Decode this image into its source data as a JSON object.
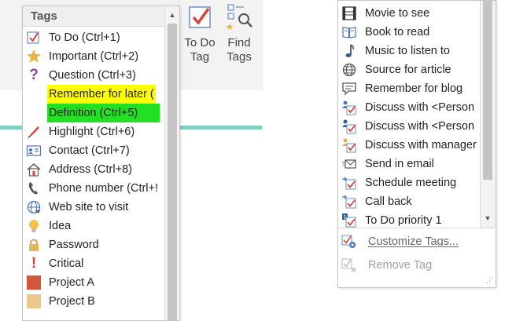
{
  "ribbon": {
    "todo_tag_label": [
      "To Do",
      "Tag"
    ],
    "find_tags_label": [
      "Find",
      "Tags"
    ]
  },
  "left_menu": {
    "header": "Tags",
    "items": [
      {
        "label": "To Do (Ctrl+1)",
        "icon": "checkbox-icon"
      },
      {
        "label": "Important (Ctrl+2)",
        "icon": "star-icon"
      },
      {
        "label": "Question (Ctrl+3)",
        "icon": "question-icon"
      },
      {
        "label": "Remember for later (",
        "icon": "",
        "highlight": "#ffff00"
      },
      {
        "label": "Definition (Ctrl+5)",
        "icon": "",
        "highlight": "#22e022"
      },
      {
        "label": "Highlight (Ctrl+6)",
        "icon": "highlighter-icon"
      },
      {
        "label": "Contact (Ctrl+7)",
        "icon": "contact-card-icon"
      },
      {
        "label": "Address (Ctrl+8)",
        "icon": "house-icon"
      },
      {
        "label": "Phone number (Ctrl+!",
        "icon": "phone-icon"
      },
      {
        "label": "Web site to visit",
        "icon": "globe-icon"
      },
      {
        "label": "Idea",
        "icon": "lightbulb-icon"
      },
      {
        "label": "Password",
        "icon": "padlock-icon"
      },
      {
        "label": "Critical",
        "icon": "exclamation-icon"
      },
      {
        "label": "Project A",
        "icon": "red-square-icon"
      },
      {
        "label": "Project B",
        "icon": "tan-square-icon"
      }
    ]
  },
  "right_menu": {
    "items": [
      {
        "label": "Movie to see",
        "icon": "film-icon"
      },
      {
        "label": "Book to read",
        "icon": "book-icon"
      },
      {
        "label": "Music to listen to",
        "icon": "music-note-icon"
      },
      {
        "label": "Source for article",
        "icon": "globe-icon"
      },
      {
        "label": "Remember for blog",
        "icon": "speech-bubble-icon"
      },
      {
        "label": "Discuss with <Person",
        "icon": "person-check-icon"
      },
      {
        "label": "Discuss with <Person",
        "icon": "person-check-icon"
      },
      {
        "label": "Discuss with manager",
        "icon": "manager-check-icon"
      },
      {
        "label": "Send in email",
        "icon": "email-icon"
      },
      {
        "label": "Schedule meeting",
        "icon": "calendar-check-icon"
      },
      {
        "label": "Call back",
        "icon": "callback-check-icon"
      },
      {
        "label": "To Do priority 1",
        "icon": "priority-check-icon"
      }
    ],
    "customize_label": "Customize Tags...",
    "remove_label": "Remove Tag"
  },
  "colors": {
    "accent_red": "#d9443a",
    "highlight_yellow": "#ffff00",
    "highlight_green": "#22e022",
    "teal_line": "#7ecfc0"
  }
}
